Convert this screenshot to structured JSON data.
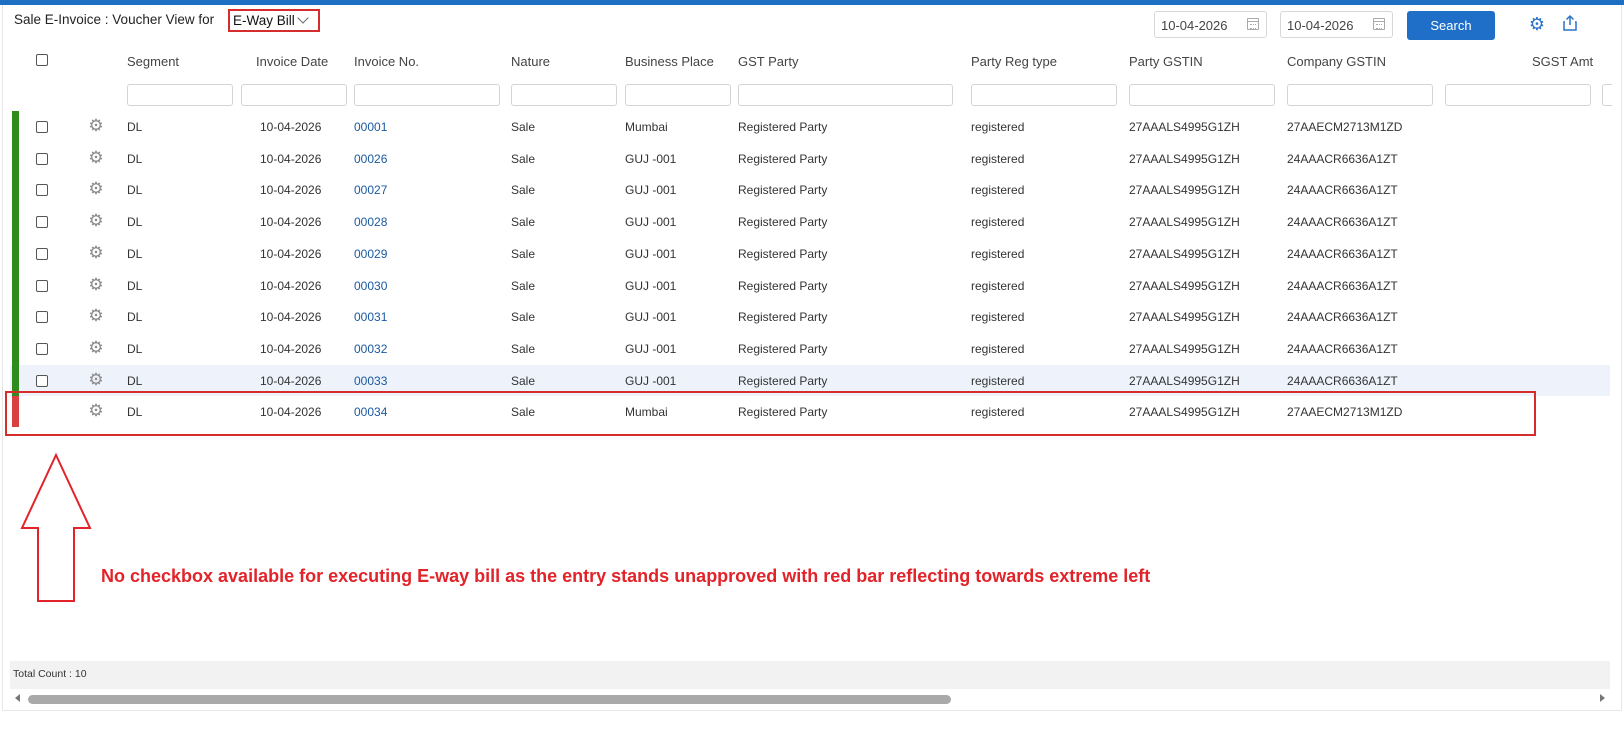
{
  "colors": {
    "accent": "#1f6ec7",
    "approved_bar": "#2e8b1e",
    "unapproved_bar": "#d94040",
    "annotation": "#e2232a"
  },
  "header": {
    "title": "Sale E-Invoice : Voucher View for",
    "mode": "E-Way Bill",
    "from_date": "10-04-2026",
    "to_date": "10-04-2026",
    "search_label": "Search",
    "settings_icon": "gear-icon",
    "export_icon": "share-export-icon"
  },
  "columns": [
    "Segment",
    "Invoice Date",
    "Invoice No.",
    "Nature",
    "Business Place",
    "GST Party",
    "Party Reg type",
    "Party GSTIN",
    "Company GSTIN",
    "SGST Amt"
  ],
  "rows": [
    {
      "segment": "DL",
      "date": "10-04-2026",
      "invoice_no": "00001",
      "nature": "Sale",
      "place": "Mumbai",
      "party": "Registered Party",
      "reg_type": "registered",
      "party_gstin": "27AAALS4995G1ZH",
      "company_gstin": "27AAECM2713M1ZD",
      "approved": true
    },
    {
      "segment": "DL",
      "date": "10-04-2026",
      "invoice_no": "00026",
      "nature": "Sale",
      "place": "GUJ -001",
      "party": "Registered Party",
      "reg_type": "registered",
      "party_gstin": "27AAALS4995G1ZH",
      "company_gstin": "24AAACR6636A1ZT",
      "approved": true
    },
    {
      "segment": "DL",
      "date": "10-04-2026",
      "invoice_no": "00027",
      "nature": "Sale",
      "place": "GUJ -001",
      "party": "Registered Party",
      "reg_type": "registered",
      "party_gstin": "27AAALS4995G1ZH",
      "company_gstin": "24AAACR6636A1ZT",
      "approved": true
    },
    {
      "segment": "DL",
      "date": "10-04-2026",
      "invoice_no": "00028",
      "nature": "Sale",
      "place": "GUJ -001",
      "party": "Registered Party",
      "reg_type": "registered",
      "party_gstin": "27AAALS4995G1ZH",
      "company_gstin": "24AAACR6636A1ZT",
      "approved": true
    },
    {
      "segment": "DL",
      "date": "10-04-2026",
      "invoice_no": "00029",
      "nature": "Sale",
      "place": "GUJ -001",
      "party": "Registered Party",
      "reg_type": "registered",
      "party_gstin": "27AAALS4995G1ZH",
      "company_gstin": "24AAACR6636A1ZT",
      "approved": true
    },
    {
      "segment": "DL",
      "date": "10-04-2026",
      "invoice_no": "00030",
      "nature": "Sale",
      "place": "GUJ -001",
      "party": "Registered Party",
      "reg_type": "registered",
      "party_gstin": "27AAALS4995G1ZH",
      "company_gstin": "24AAACR6636A1ZT",
      "approved": true
    },
    {
      "segment": "DL",
      "date": "10-04-2026",
      "invoice_no": "00031",
      "nature": "Sale",
      "place": "GUJ -001",
      "party": "Registered Party",
      "reg_type": "registered",
      "party_gstin": "27AAALS4995G1ZH",
      "company_gstin": "24AAACR6636A1ZT",
      "approved": true
    },
    {
      "segment": "DL",
      "date": "10-04-2026",
      "invoice_no": "00032",
      "nature": "Sale",
      "place": "GUJ -001",
      "party": "Registered Party",
      "reg_type": "registered",
      "party_gstin": "27AAALS4995G1ZH",
      "company_gstin": "24AAACR6636A1ZT",
      "approved": true
    },
    {
      "segment": "DL",
      "date": "10-04-2026",
      "invoice_no": "00033",
      "nature": "Sale",
      "place": "GUJ -001",
      "party": "Registered Party",
      "reg_type": "registered",
      "party_gstin": "27AAALS4995G1ZH",
      "company_gstin": "24AAACR6636A1ZT",
      "approved": true
    },
    {
      "segment": "DL",
      "date": "10-04-2026",
      "invoice_no": "00034",
      "nature": "Sale",
      "place": "Mumbai",
      "party": "Registered Party",
      "reg_type": "registered",
      "party_gstin": "27AAALS4995G1ZH",
      "company_gstin": "27AAECM2713M1ZD",
      "approved": false
    }
  ],
  "annotation": "No checkbox available for executing E-way bill as the entry stands unapproved with red bar reflecting towards extreme left",
  "footer": {
    "total_count": "Total Count : 10"
  }
}
